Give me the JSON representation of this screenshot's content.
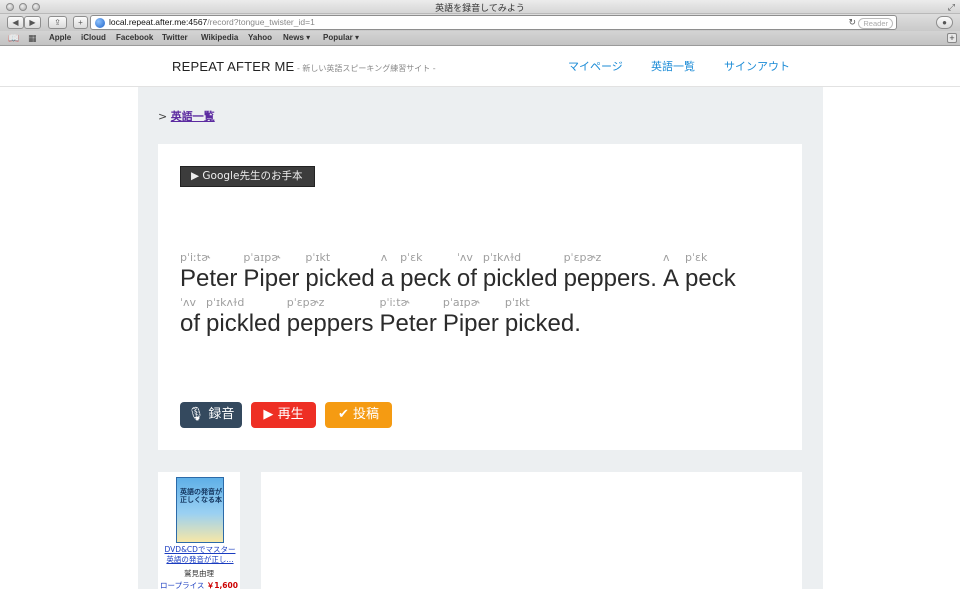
{
  "browser": {
    "window_title": "英語を録音してみよう",
    "url_host": "local.repeat.after.me:4567",
    "url_path": "/record?tongue_twister_id=1",
    "reader_label": "Reader",
    "bookmarks": [
      "Apple",
      "iCloud",
      "Facebook",
      "Twitter",
      "Wikipedia",
      "Yahoo",
      "News ▾",
      "Popular ▾"
    ]
  },
  "header": {
    "logo": "REPEAT AFTER ME",
    "tagline": "- 新しい英語スピーキング練習サイト -",
    "nav": [
      "マイページ",
      "英語一覧",
      "サインアウト"
    ]
  },
  "breadcrumb": {
    "prefix": ">",
    "link": "英語一覧"
  },
  "card": {
    "google_button": "▶ Google先生のお手本",
    "lines": [
      [
        {
          "text": "Peter",
          "ipa": "pˈiːtɚ"
        },
        {
          "text": "Piper",
          "ipa": "pˈaɪpɚ"
        },
        {
          "text": "picked",
          "ipa": "pˈɪkt"
        },
        {
          "text": "a",
          "ipa": "ʌ"
        },
        {
          "text": "peck",
          "ipa": "pˈɛk"
        },
        {
          "text": "of",
          "ipa": "ˈʌv"
        },
        {
          "text": "pickled",
          "ipa": "pˈɪkʌɫd"
        },
        {
          "text": "peppers.",
          "ipa": "pˈɛpɚz"
        },
        {
          "text": "A",
          "ipa": "ʌ"
        },
        {
          "text": "peck",
          "ipa": "pˈɛk"
        }
      ],
      [
        {
          "text": "of",
          "ipa": "ˈʌv"
        },
        {
          "text": "pickled",
          "ipa": "pˈɪkʌɫd"
        },
        {
          "text": "peppers",
          "ipa": "pˈɛpɚz"
        },
        {
          "text": "Peter",
          "ipa": "pˈiːtɚ"
        },
        {
          "text": "Piper",
          "ipa": "pˈaɪpɚ"
        },
        {
          "text": "picked.",
          "ipa": "pˈɪkt"
        }
      ]
    ],
    "buttons": {
      "record": "録音",
      "play": "再生",
      "post": "投稿"
    },
    "colors": {
      "record": "#34495e",
      "play": "#ee2f24",
      "post": "#f59b12"
    }
  },
  "ad": {
    "cover_text": "英語の発音が正しくなる本",
    "link": "DVD&CDでマスター 英語の発音が正し...",
    "author": "鷲見由理",
    "price_label": "ロープライス",
    "price": "￥1,600"
  }
}
